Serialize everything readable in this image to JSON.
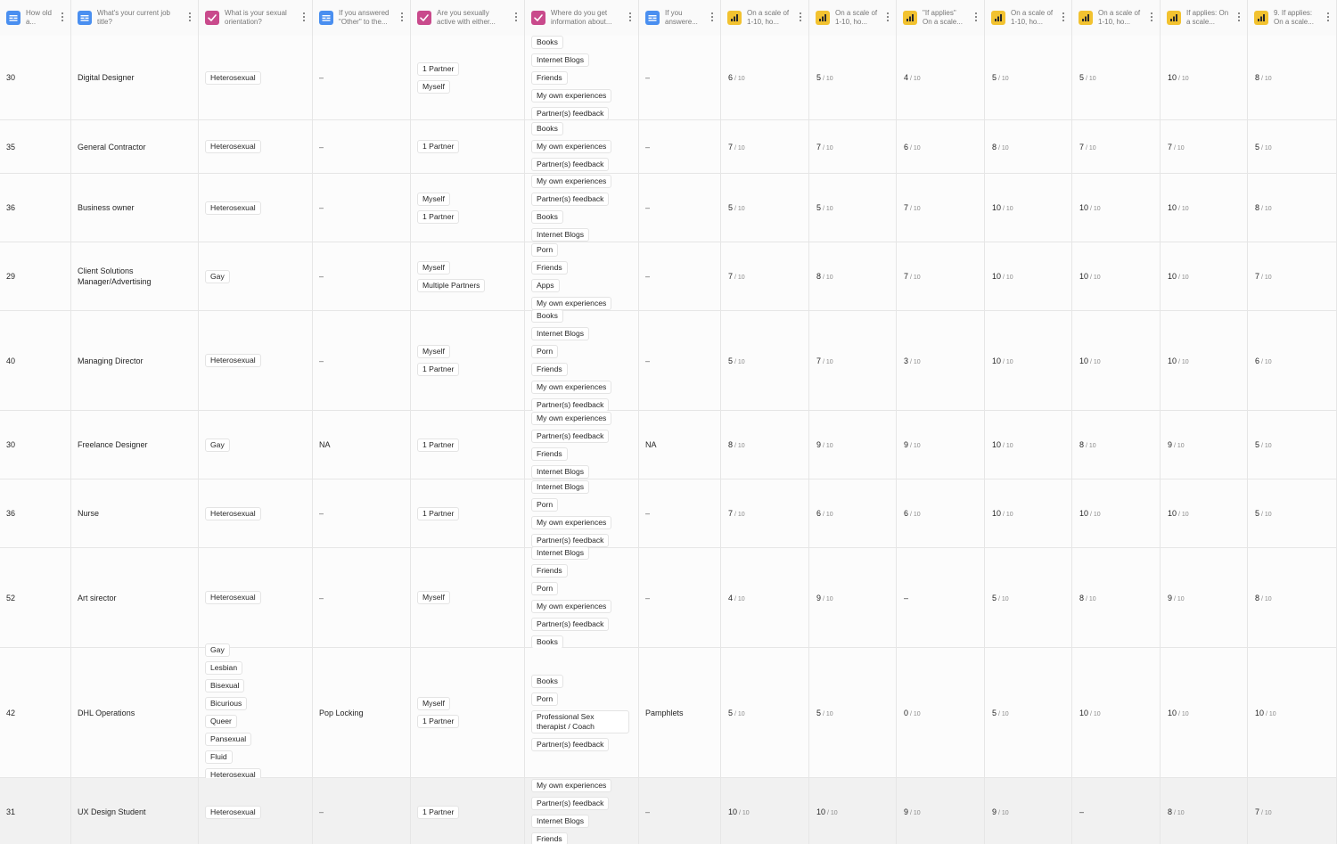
{
  "columns": [
    {
      "id": "age",
      "title": "How old a...",
      "type": "text-icon",
      "color": "#4a8ff0"
    },
    {
      "id": "job",
      "title": "What's your current job title?",
      "type": "text-icon",
      "color": "#4a8ff0"
    },
    {
      "id": "orient",
      "title": "What is your sexual orientation?",
      "type": "check-icon",
      "color": "#c94a8c"
    },
    {
      "id": "other",
      "title": "If you answered \"Other\" to the...",
      "type": "text-icon",
      "color": "#4a8ff0"
    },
    {
      "id": "active",
      "title": "Are you sexually active with either...",
      "type": "check-icon",
      "color": "#c94a8c"
    },
    {
      "id": "info",
      "title": "Where do you get information about...",
      "type": "check-icon",
      "color": "#c94a8c"
    },
    {
      "id": "if2",
      "title": "If you answere...",
      "type": "text-icon",
      "color": "#4a8ff0"
    },
    {
      "id": "s1",
      "title": "On a scale of 1-10, ho...",
      "type": "rating-icon",
      "color": "#f2c230"
    },
    {
      "id": "s2",
      "title": "On a scale of 1-10, ho...",
      "type": "rating-icon",
      "color": "#f2c230"
    },
    {
      "id": "s3",
      "title": "\"If applies\" On a scale...",
      "type": "rating-icon",
      "color": "#f2c230"
    },
    {
      "id": "s4",
      "title": "On a scale of 1-10, ho...",
      "type": "rating-icon",
      "color": "#f2c230"
    },
    {
      "id": "s5",
      "title": "On a scale of 1-10, ho...",
      "type": "rating-icon",
      "color": "#f2c230"
    },
    {
      "id": "s6",
      "title": "If applies: On a scale...",
      "type": "rating-icon",
      "color": "#f2c230"
    },
    {
      "id": "s7",
      "title": "9. If applies: On a scale...",
      "type": "rating-icon",
      "color": "#f2c230"
    }
  ],
  "rating_max": "10",
  "rows": [
    {
      "age": "30",
      "job": "Digital Designer",
      "orient": [
        "Heterosexual"
      ],
      "other": "–",
      "active": [
        "1 Partner",
        "Myself"
      ],
      "info": [
        "Books",
        "Internet Blogs",
        "Friends",
        "My own experiences",
        "Partner(s) feedback"
      ],
      "if2": "–",
      "ratings": [
        "6",
        "5",
        "4",
        "5",
        "5",
        "10",
        "8"
      ]
    },
    {
      "age": "35",
      "job": "General Contractor",
      "orient": [
        "Heterosexual"
      ],
      "other": "–",
      "active": [
        "1 Partner"
      ],
      "info": [
        "Books",
        "My own experiences",
        "Partner(s) feedback"
      ],
      "if2": "–",
      "ratings": [
        "7",
        "7",
        "6",
        "8",
        "7",
        "7",
        "5"
      ]
    },
    {
      "age": "36",
      "job": "Business owner",
      "orient": [
        "Heterosexual"
      ],
      "other": "–",
      "active": [
        "Myself",
        "1 Partner"
      ],
      "info": [
        "My own experiences",
        "Partner(s) feedback",
        "Books",
        "Internet Blogs"
      ],
      "if2": "–",
      "ratings": [
        "5",
        "5",
        "7",
        "10",
        "10",
        "10",
        "8"
      ]
    },
    {
      "age": "29",
      "job": "Client Solutions Manager/Advertising",
      "orient": [
        "Gay"
      ],
      "other": "–",
      "active": [
        "Myself",
        "Multiple Partners"
      ],
      "info": [
        "Porn",
        "Friends",
        "Apps",
        "My own experiences"
      ],
      "if2": "–",
      "ratings": [
        "7",
        "8",
        "7",
        "10",
        "10",
        "10",
        "7"
      ]
    },
    {
      "age": "40",
      "job": "Managing Director",
      "orient": [
        "Heterosexual"
      ],
      "other": "–",
      "active": [
        "Myself",
        "1 Partner"
      ],
      "info": [
        "Books",
        "Internet Blogs",
        "Porn",
        "Friends",
        "My own experiences",
        "Partner(s) feedback"
      ],
      "if2": "–",
      "ratings": [
        "5",
        "7",
        "3",
        "10",
        "10",
        "10",
        "6"
      ]
    },
    {
      "age": "30",
      "job": "Freelance Designer",
      "orient": [
        "Gay"
      ],
      "other": "NA",
      "active": [
        "1 Partner"
      ],
      "info": [
        "My own experiences",
        "Partner(s) feedback",
        "Friends",
        "Internet Blogs"
      ],
      "if2": "NA",
      "ratings": [
        "8",
        "9",
        "9",
        "10",
        "8",
        "9",
        "5"
      ]
    },
    {
      "age": "36",
      "job": "Nurse",
      "orient": [
        "Heterosexual"
      ],
      "other": "–",
      "active": [
        "1 Partner"
      ],
      "info": [
        "Internet Blogs",
        "Porn",
        "My own experiences",
        "Partner(s) feedback"
      ],
      "if2": "–",
      "ratings": [
        "7",
        "6",
        "6",
        "10",
        "10",
        "10",
        "5"
      ]
    },
    {
      "age": "52",
      "job": "Art sirector",
      "orient": [
        "Heterosexual"
      ],
      "other": "–",
      "active": [
        "Myself"
      ],
      "info": [
        "Internet Blogs",
        "Friends",
        "Porn",
        "My own experiences",
        "Partner(s) feedback",
        "Books"
      ],
      "if2": "–",
      "ratings": [
        "4",
        "9",
        "–",
        "5",
        "8",
        "9",
        "8"
      ]
    },
    {
      "age": "42",
      "job": "DHL Operations",
      "orient": [
        "Gay",
        "Lesbian",
        "Bisexual",
        "Bicurious",
        "Queer",
        "Pansexual",
        "Fluid",
        "Heterosexual"
      ],
      "other": "Pop Locking",
      "active": [
        "Myself",
        "1 Partner"
      ],
      "info": [
        "Books",
        "Porn",
        "Professional Sex therapist / Coach",
        "Partner(s) feedback"
      ],
      "if2": "Pamphlets",
      "ratings": [
        "5",
        "5",
        "0",
        "5",
        "10",
        "10",
        "10"
      ]
    },
    {
      "age": "31",
      "job": "UX Design Student",
      "orient": [
        "Heterosexual"
      ],
      "other": "–",
      "active": [
        "1 Partner"
      ],
      "info": [
        "My own experiences",
        "Partner(s) feedback",
        "Internet Blogs",
        "Friends"
      ],
      "if2": "–",
      "ratings": [
        "10",
        "10",
        "9",
        "9",
        "–",
        "8",
        "7"
      ]
    }
  ]
}
